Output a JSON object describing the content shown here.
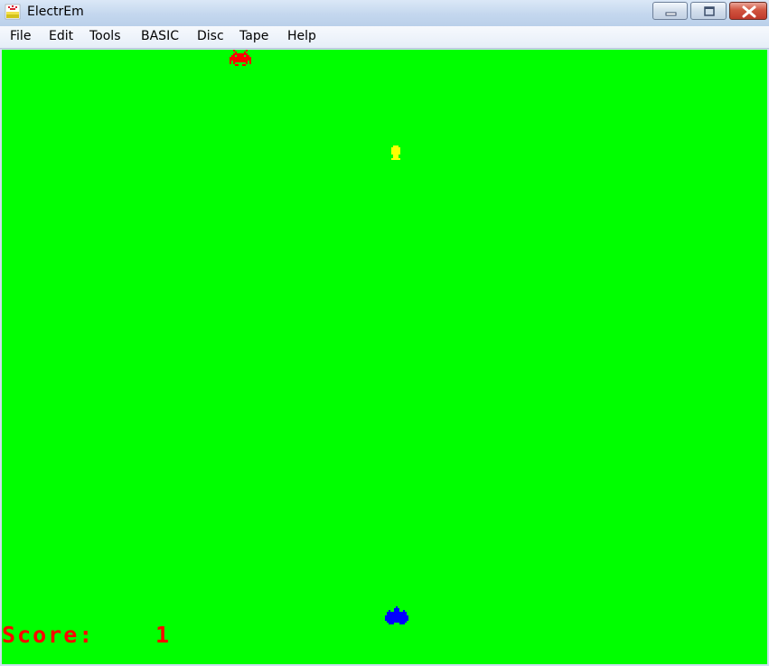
{
  "window": {
    "title": "ElectrEm",
    "icon": "electrem-app-icon",
    "controls": [
      "minimize-icon",
      "maximize-icon",
      "close-icon"
    ]
  },
  "menu": {
    "items": [
      {
        "label": "File"
      },
      {
        "label": "Edit"
      },
      {
        "label": "Tools"
      },
      {
        "label": "BASIC"
      },
      {
        "label": "Disc"
      },
      {
        "label": "Tape"
      },
      {
        "label": "Help"
      }
    ]
  },
  "game": {
    "background_color": "#00ff00",
    "score_label": "Score:",
    "score_value": "1",
    "score_color": "#ff0000",
    "sprites": {
      "enemy": {
        "icon": "alien-invader-icon",
        "color": "#ff0000"
      },
      "bullet": {
        "icon": "bullet-icon",
        "color": "#ffff00"
      },
      "player": {
        "icon": "player-ship-icon",
        "color": "#0000ff"
      }
    }
  }
}
